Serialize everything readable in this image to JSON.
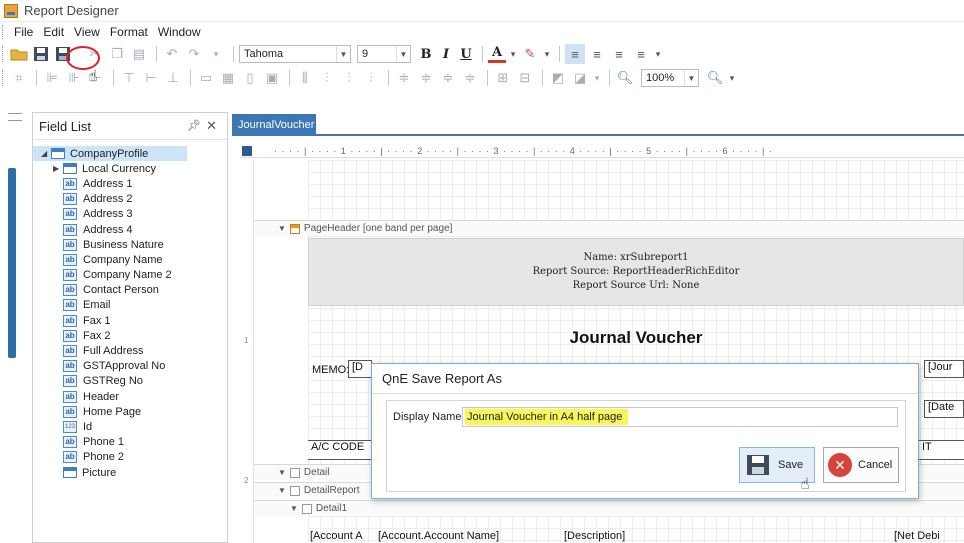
{
  "window": {
    "title": "Report Designer"
  },
  "menu": [
    "File",
    "Edit",
    "View",
    "Format",
    "Window"
  ],
  "toolbar": {
    "font_name": "Tahoma",
    "font_size": "9",
    "zoom": "100%"
  },
  "field_list": {
    "title": "Field List",
    "root": "CompanyProfile",
    "child": "Local Currency",
    "fields": [
      {
        "label": "Address 1",
        "icon": "ab"
      },
      {
        "label": "Address 2",
        "icon": "ab"
      },
      {
        "label": "Address 3",
        "icon": "ab"
      },
      {
        "label": "Address 4",
        "icon": "ab"
      },
      {
        "label": "Business Nature",
        "icon": "ab"
      },
      {
        "label": "Company Name",
        "icon": "ab"
      },
      {
        "label": "Company Name 2",
        "icon": "ab"
      },
      {
        "label": "Contact Person",
        "icon": "ab"
      },
      {
        "label": "Email",
        "icon": "ab"
      },
      {
        "label": "Fax 1",
        "icon": "ab"
      },
      {
        "label": "Fax 2",
        "icon": "ab"
      },
      {
        "label": "Full Address",
        "icon": "ab"
      },
      {
        "label": "GSTApproval No",
        "icon": "ab"
      },
      {
        "label": "GSTReg No",
        "icon": "ab"
      },
      {
        "label": "Header",
        "icon": "ab"
      },
      {
        "label": "Home Page",
        "icon": "ab"
      },
      {
        "label": "Id",
        "icon": "123"
      },
      {
        "label": "Phone 1",
        "icon": "ab"
      },
      {
        "label": "Phone 2",
        "icon": "ab"
      },
      {
        "label": "Picture",
        "icon": "table"
      }
    ]
  },
  "document": {
    "tab": "JournalVoucher",
    "ruler_marks": "· · · · | · · · · 1 · · · · | · · · · 2 · · · · | · · · · 3 · · · · | · · · · 4 · · · · | · · · · 5 · · · · | · · · · 6 · · · · | ·",
    "vruler_marks": [
      "1",
      "2"
    ],
    "page_header_band": "PageHeader [one band per page]",
    "subreport_lines": [
      "Name: xrSubreport1",
      "Report Source: ReportHeaderRichEditor",
      "Report Source Url: None"
    ],
    "report_title": "Journal Voucher",
    "memo_label": "MEMO:",
    "memo_field": "[D",
    "right_field_1": "[Jour",
    "right_field_2": "[Date",
    "ac_code": "A/C CODE",
    "right_field_3": "IT",
    "detail_band": "Detail",
    "detail_report_band": "DetailReport",
    "detail1_band": "Detail1",
    "detail_fields": [
      "[Account A",
      "[Account.Account Name]",
      "[Description]",
      "[Net Debi"
    ]
  },
  "dialog": {
    "title": "QnE Save Report As",
    "display_name_label": "Display Name",
    "display_name_value": "Journal Voucher in A4 half page",
    "save_label": "Save",
    "cancel_label": "Cancel"
  },
  "colors": {
    "accent": "#3c76b5",
    "highlight": "#f8f75a",
    "circle": "#e0202a"
  }
}
